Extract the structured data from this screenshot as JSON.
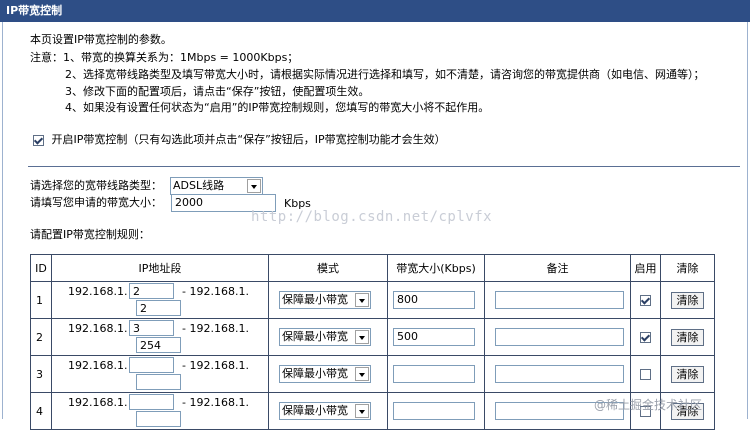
{
  "title": "IP带宽控制",
  "intro": "本页设置IP带宽控制的参数。",
  "notes": [
    "注意：1、带宽的换算关系为：1Mbps = 1000Kbps；",
    "2、选择宽带线路类型及填写带宽大小时，请根据实际情况进行选择和填写，如不清楚，请咨询您的带宽提供商（如电信、网通等）；",
    "3、修改下面的配置项后，请点击“保存”按钮，使配置项生效。",
    "4、如果没有设置任何状态为“启用”的IP带宽控制规则，您填写的带宽大小将不起作用。"
  ],
  "enable": {
    "checked": true,
    "label": "开启IP带宽控制（只有勾选此项并点击“保存”按钮后，IP带宽控制功能才会生效）"
  },
  "line_type": {
    "label": "请选择您的宽带线路类型：",
    "value": "ADSL线路"
  },
  "bandwidth": {
    "label": "请填写您申请的带宽大小：",
    "value": "2000",
    "unit": "Kbps"
  },
  "rules_title": "请配置IP带宽控制规则：",
  "table": {
    "headers": [
      "ID",
      "IP地址段",
      "模式",
      "带宽大小(Kbps)",
      "备注",
      "启用",
      "清除"
    ],
    "ip_prefix": "192.168.1.",
    "ip_sep": "- 192.168.1.",
    "rows": [
      {
        "id": "1",
        "start": "2",
        "end": "2",
        "mode": "保障最小带宽",
        "bw": "800",
        "note": "",
        "enabled": true,
        "clear": "清除"
      },
      {
        "id": "2",
        "start": "3",
        "end": "254",
        "mode": "保障最小带宽",
        "bw": "500",
        "note": "",
        "enabled": true,
        "clear": "清除"
      },
      {
        "id": "3",
        "start": "",
        "end": "",
        "mode": "保障最小带宽",
        "bw": "",
        "note": "",
        "enabled": false,
        "clear": "清除"
      },
      {
        "id": "4",
        "start": "",
        "end": "",
        "mode": "保障最小带宽",
        "bw": "",
        "note": "",
        "enabled": false,
        "clear": "清除"
      }
    ]
  },
  "watermark": "http://blog.csdn.net/cplvfx",
  "corner_watermark": "@稀土掘金技术社区"
}
